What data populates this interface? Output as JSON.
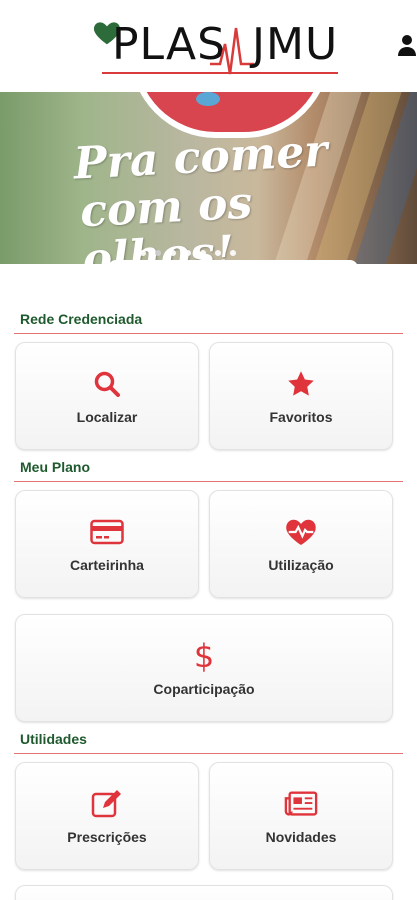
{
  "brand": {
    "logo_left": "PLAS",
    "logo_right": "JMU",
    "accent_color": "#e0343c",
    "section_color": "#1f5a2e"
  },
  "header": {
    "user_icon": "user-icon"
  },
  "banner": {
    "line1": "Pra comer",
    "line2": "com os olhos!",
    "dots_count": 7,
    "active_dot": 1
  },
  "sections": [
    {
      "title": "Rede Credenciada",
      "items": [
        {
          "label": "Localizar",
          "icon": "search-icon"
        },
        {
          "label": "Favoritos",
          "icon": "star-icon"
        }
      ]
    },
    {
      "title": "Meu Plano",
      "items": [
        {
          "label": "Carteirinha",
          "icon": "card-icon"
        },
        {
          "label": "Utilização",
          "icon": "heartbeat-icon"
        },
        {
          "label": "Coparticipação",
          "icon": "dollar-icon"
        }
      ]
    },
    {
      "title": "Utilidades",
      "items": [
        {
          "label": "Prescrições",
          "icon": "edit-icon"
        },
        {
          "label": "Novidades",
          "icon": "newspaper-icon"
        }
      ]
    }
  ]
}
